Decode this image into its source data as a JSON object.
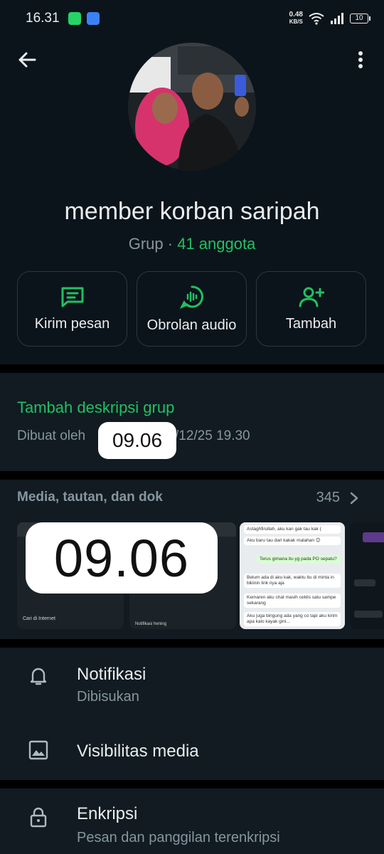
{
  "status_bar": {
    "time": "16.31",
    "net_speed": "0.48",
    "net_unit": "KB/S",
    "battery": "10"
  },
  "header": {
    "back_icon": "arrow-left-icon",
    "more_icon": "more-vert-icon"
  },
  "group": {
    "name": "member korban saripah",
    "type": "Grup",
    "separator": " · ",
    "members": "41 anggota"
  },
  "actions": [
    {
      "label": "Kirim pesan",
      "icon": "message-icon"
    },
    {
      "label": "Obrolan audio",
      "icon": "audio-chat-icon"
    },
    {
      "label": "Tambah",
      "icon": "add-person-icon"
    }
  ],
  "description": {
    "add_label": "Tambah deskripsi grup",
    "created_prefix": "Dibuat oleh ",
    "created_date": "7/12/25 19.30",
    "overlay_time": "09.06"
  },
  "media": {
    "title": "Media, tautan, dan dok",
    "count": "345",
    "overlay_time": "09.06",
    "chat_snippets": [
      "Astaghfirullah, aku kan gak tau kak (",
      "Aku baru tau dari kakak malahan 😊",
      "Terus gimana itu yg pada PO sepatu?",
      "Belum ada di aku kak, waktu itu di minta in bikinin link nya aja",
      "Kemaren aku chat masih ceklis satu sampe sekarang",
      "Aku juga bingung ada yang co tapi aku kirim apa kalo kayak gini..."
    ],
    "thumb1_text": "Cari di Internet",
    "thumb2_text": "Notifikasi hening"
  },
  "settings": [
    {
      "title": "Notifikasi",
      "subtitle": "Dibisukan",
      "icon": "bell-icon"
    },
    {
      "title": "Visibilitas media",
      "subtitle": "",
      "icon": "image-icon"
    },
    {
      "title": "Enkripsi",
      "subtitle": "Pesan dan panggilan terenkripsi",
      "icon": "lock-icon"
    }
  ],
  "colors": {
    "accent": "#21c063",
    "background": "#0b141a",
    "surface": "#111b21"
  }
}
